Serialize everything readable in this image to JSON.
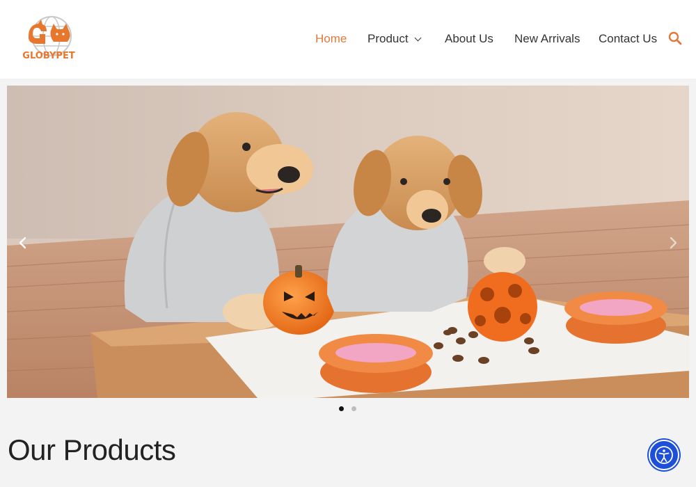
{
  "brand": {
    "name": "GLOBYPET",
    "accent_color": "#e8772e"
  },
  "nav": {
    "items": [
      {
        "label": "Home",
        "active": true
      },
      {
        "label": "Product",
        "has_dropdown": true
      },
      {
        "label": "About Us"
      },
      {
        "label": "New Arrivals"
      },
      {
        "label": "Contact Us"
      }
    ],
    "search_icon": "search-icon"
  },
  "slider": {
    "image_description": "Two golden retrievers in grey hoodies with pumpkin toy, orange treat ball and orange bowls",
    "current_slide": 1,
    "total_slides": 2,
    "prev_icon": "chevron-left-icon",
    "next_icon": "chevron-right-icon"
  },
  "products_section": {
    "title": "Our Products"
  },
  "accessibility": {
    "icon": "accessibility-icon",
    "color": "#1d4fd8"
  }
}
